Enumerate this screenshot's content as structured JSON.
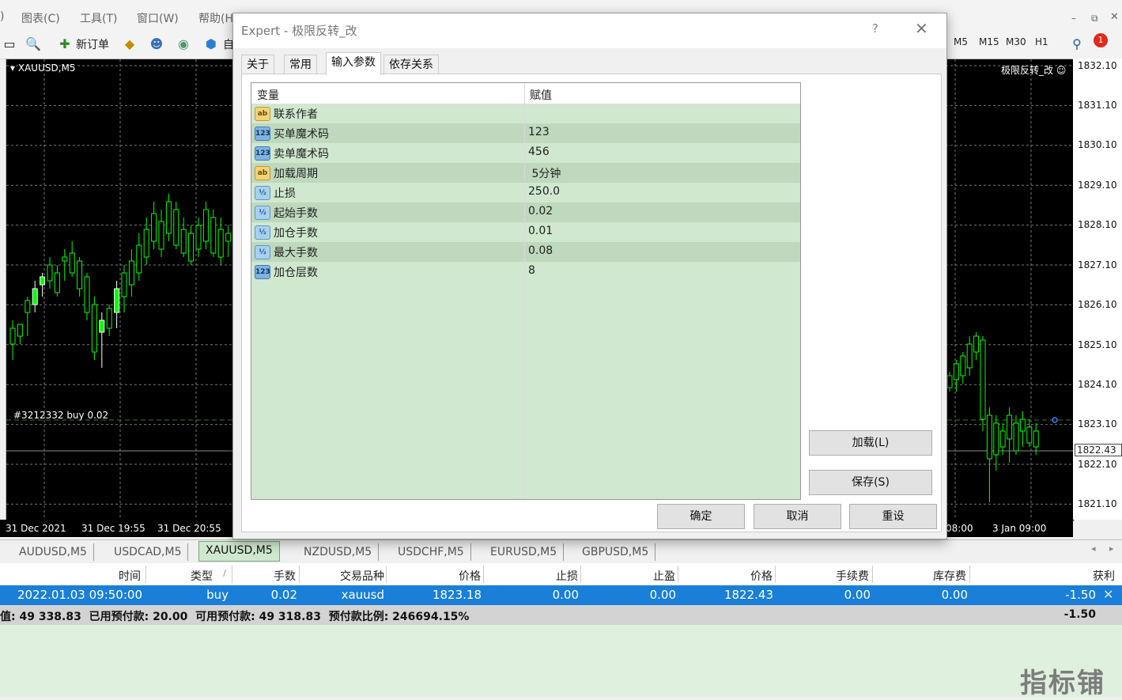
{
  "menu": [
    "图表(C)",
    "工具(T)",
    "窗口(W)",
    "帮助(H"
  ],
  "toolbar": {
    "new_order": "新订单",
    "auto_partial": "自",
    "timeframes": [
      "M5",
      "M15",
      "M30",
      "H1"
    ],
    "notification_count": "1"
  },
  "chart": {
    "symbol": "XAUUSD,M5",
    "ea_label": "极限反转_改",
    "order_label": "#3212332 buy 0.02",
    "current_price": "1822.43",
    "price_ticks": [
      "1832.10",
      "1831.10",
      "1830.10",
      "1829.10",
      "1828.10",
      "1827.10",
      "1826.10",
      "1825.10",
      "1824.10",
      "1823.10",
      "1822.10",
      "1821.10"
    ],
    "time_ticks": [
      "31 Dec 2021",
      "31 Dec 19:55",
      "31 Dec 20:55",
      "08:00",
      "3 Jan 09:00"
    ],
    "colors": {
      "bull": "#00ff00",
      "bear": "#ffffff",
      "background": "#000000"
    }
  },
  "chart_tabs": [
    "AUDUSD,M5",
    "USDCAD,M5",
    "XAUUSD,M5",
    "NZDUSD,M5",
    "USDCHF,M5",
    "EURUSD,M5",
    "GBPUSD,M5"
  ],
  "active_chart_tab": "XAUUSD,M5",
  "terminal": {
    "headers": [
      "时间",
      "类型",
      "手数",
      "交易品种",
      "价格",
      "止损",
      "止盈",
      "价格",
      "手续费",
      "库存费",
      "获利"
    ],
    "sort_mark": "/",
    "row": [
      "2022.01.03 09:50:00",
      "buy",
      "0.02",
      "xauusd",
      "1823.18",
      "0.00",
      "0.00",
      "1822.43",
      "0.00",
      "0.00",
      "-1.50"
    ],
    "summary": "值: 49 338.83  已用预付款: 20.00  可用预付款: 49 318.83  预付款比例: 246694.15%",
    "summary_profit": "-1.50"
  },
  "dialog": {
    "title": "Expert - 极限反转_改",
    "help": "?",
    "tabs": [
      "关于",
      "常用",
      "输入参数",
      "依存关系"
    ],
    "active_tab": "输入参数",
    "grid_headers": [
      "变量",
      "赋值"
    ],
    "params": [
      {
        "type": "ab",
        "name": "联系作者",
        "value": ""
      },
      {
        "type": "123",
        "name": "买单魔术码",
        "value": "123"
      },
      {
        "type": "123",
        "name": "卖单魔术码",
        "value": "456"
      },
      {
        "type": "ab",
        "name": "加载周期",
        "value": " 5分钟"
      },
      {
        "type": "frac",
        "name": "止损",
        "value": "250.0"
      },
      {
        "type": "frac",
        "name": "起始手数",
        "value": "0.02"
      },
      {
        "type": "frac",
        "name": "加仓手数",
        "value": "0.01"
      },
      {
        "type": "frac",
        "name": "最大手数",
        "value": "0.08"
      },
      {
        "type": "123",
        "name": "加仓层数",
        "value": "8"
      }
    ],
    "load_button": "加载(L)",
    "save_button": "保存(S)",
    "ok_button": "确定",
    "cancel_button": "取消",
    "reset_button": "重设"
  },
  "watermark": "指标铺"
}
